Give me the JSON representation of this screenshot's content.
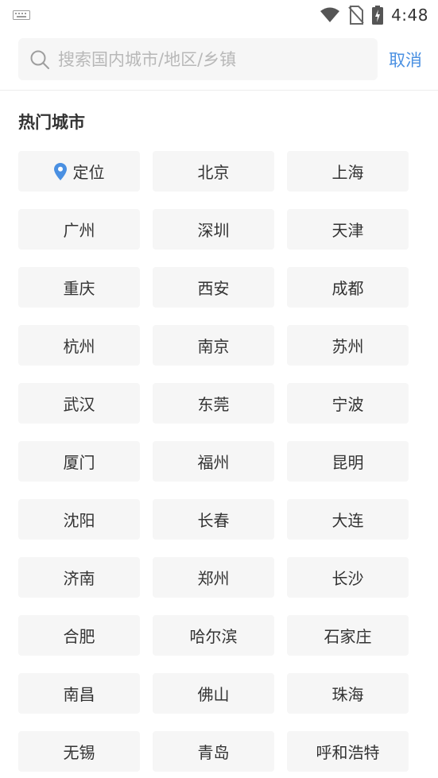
{
  "status_bar": {
    "time": "4:48"
  },
  "search": {
    "placeholder": "搜索国内城市/地区/乡镇",
    "cancel_label": "取消"
  },
  "hot_cities": {
    "title": "热门城市",
    "locate_label": "定位",
    "cities": [
      "北京",
      "上海",
      "广州",
      "深圳",
      "天津",
      "重庆",
      "西安",
      "成都",
      "杭州",
      "南京",
      "苏州",
      "武汉",
      "东莞",
      "宁波",
      "厦门",
      "福州",
      "昆明",
      "沈阳",
      "长春",
      "大连",
      "济南",
      "郑州",
      "长沙",
      "合肥",
      "哈尔滨",
      "石家庄",
      "南昌",
      "佛山",
      "珠海",
      "无锡",
      "青岛",
      "呼和浩特"
    ]
  },
  "colors": {
    "accent": "#4a90e2",
    "chip_bg": "#f6f6f6",
    "text": "#333333"
  }
}
